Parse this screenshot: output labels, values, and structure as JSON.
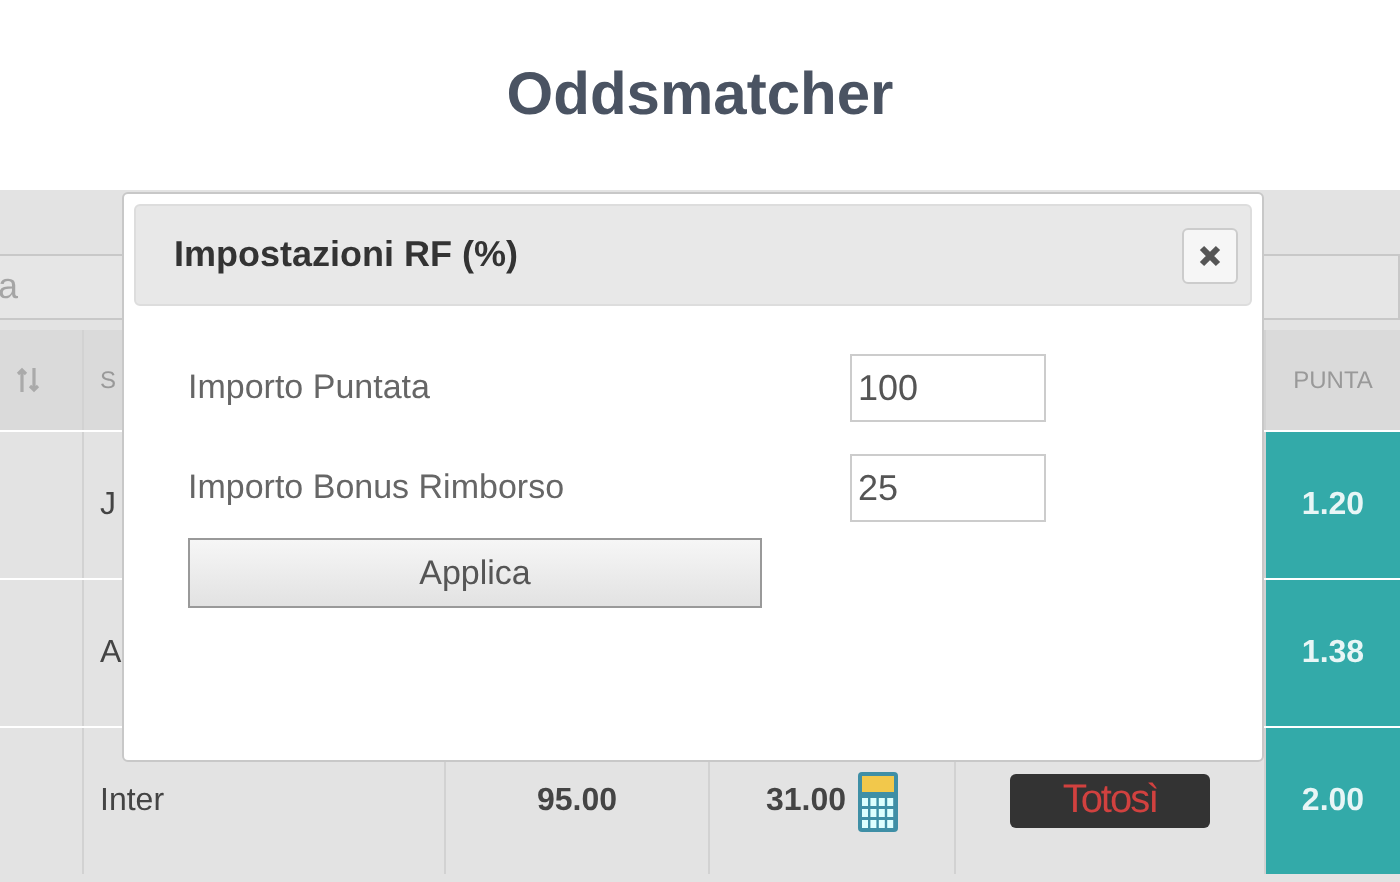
{
  "page_title": "Oddsmatcher",
  "search": {
    "placeholder": "a"
  },
  "table": {
    "columns": {
      "column_2": "S",
      "column_6": "PUNTA"
    },
    "rows": [
      {
        "team": "J",
        "back_odds": "1.20"
      },
      {
        "team": "A",
        "back_odds": "1.38"
      },
      {
        "team": "Inter",
        "column_3": "95.00",
        "column_4": "31.00",
        "bookmaker": "Totosì",
        "back_odds": "2.00"
      }
    ]
  },
  "modal": {
    "title": "Impostazioni RF (%)",
    "fields": [
      {
        "label": "Importo Puntata",
        "value": "100"
      },
      {
        "label": "Importo Bonus Rimborso",
        "value": "25"
      }
    ],
    "apply_button": "Applica"
  }
}
